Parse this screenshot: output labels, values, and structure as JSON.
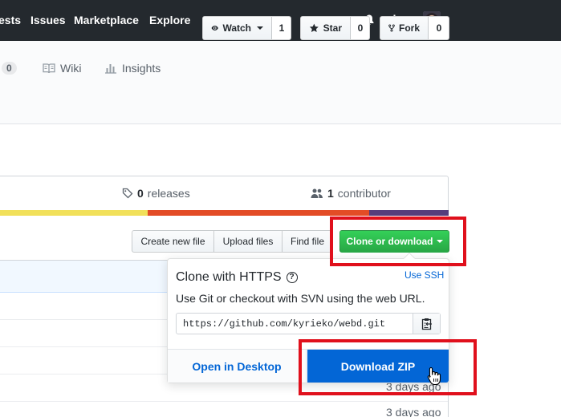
{
  "topnav": {
    "links": [
      "ests",
      "Issues",
      "Marketplace",
      "Explore"
    ]
  },
  "repo_actions": {
    "watch_label": "Watch",
    "watch_count": "1",
    "star_label": "Star",
    "star_count": "0",
    "fork_label": "Fork",
    "fork_count": "0"
  },
  "tabs": {
    "partial_counter": "0",
    "wiki": "Wiki",
    "insights": "Insights"
  },
  "summary": {
    "releases_count": "0",
    "releases_label": "releases",
    "contributors_count": "1",
    "contributors_label": "contributor"
  },
  "language_colors": [
    "#f1e05a",
    "#e34c26",
    "#563d7c"
  ],
  "file_nav": {
    "create_new_file": "Create new file",
    "upload_files": "Upload files",
    "find_file": "Find file",
    "clone_or_download": "Clone or download"
  },
  "clone_dropdown": {
    "title": "Clone with HTTPS",
    "use_ssh": "Use SSH",
    "description": "Use Git or checkout with SVN using the web URL.",
    "url": "https://github.com/kyrieko/webd.git",
    "open_in_desktop": "Open in Desktop",
    "download_zip": "Download ZIP"
  },
  "file_ages": [
    "3 days ago",
    "3 days ago"
  ],
  "colors": {
    "header_bg": "#24292e",
    "primary_green": "#28a745",
    "link_blue": "#0366d6",
    "highlight_red": "#e0101c"
  }
}
